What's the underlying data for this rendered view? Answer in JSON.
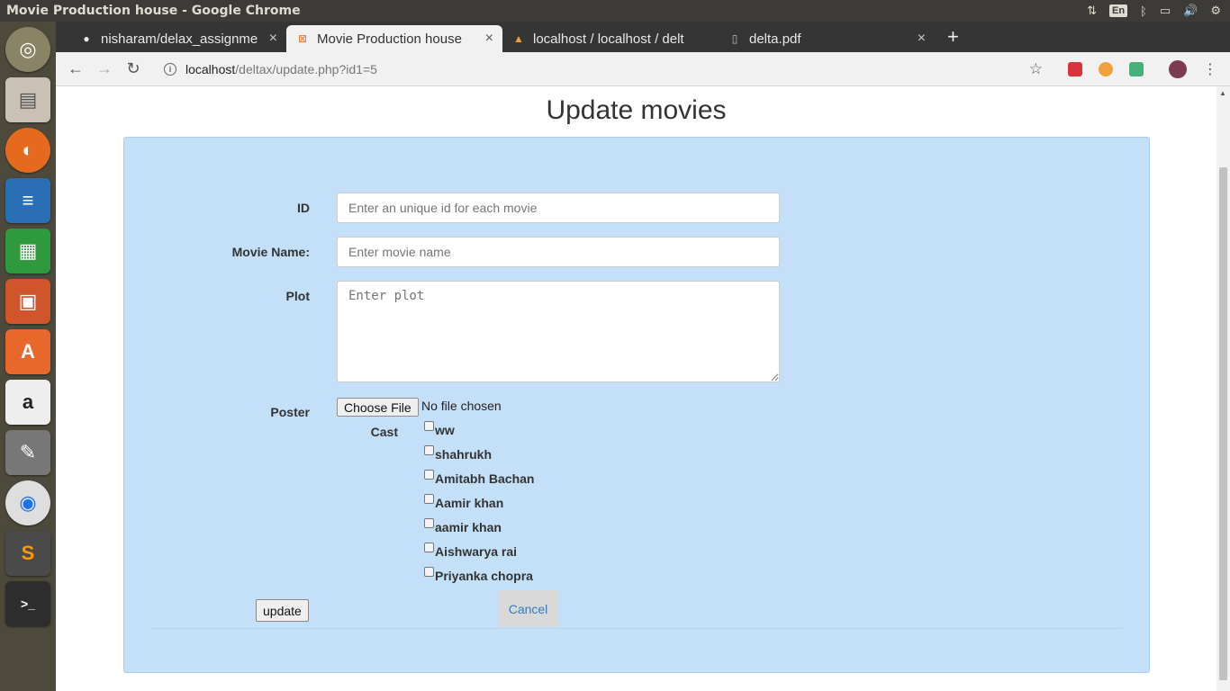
{
  "os": {
    "window_title": "Movie Production house - Google Chrome",
    "lang": "En"
  },
  "tabs": [
    {
      "label": "nisharam/delax_assignme",
      "icon": "github-icon"
    },
    {
      "label": "Movie Production house",
      "icon": "xampp-icon",
      "active": true
    },
    {
      "label": "localhost / localhost / delt",
      "icon": "phpmyadmin-icon"
    },
    {
      "label": "delta.pdf",
      "icon": "document-icon"
    }
  ],
  "toolbar": {
    "url_host": "localhost",
    "url_path": "/deltax/update.php?id1=5"
  },
  "page": {
    "title": "Update movies"
  },
  "form": {
    "id_label": "ID",
    "id_placeholder": "Enter an unique id for each movie",
    "name_label": "Movie Name:",
    "name_placeholder": "Enter movie name",
    "plot_label": "Plot",
    "plot_placeholder": "Enter plot",
    "poster_label": "Poster",
    "file_button": "Choose File",
    "file_status": "No file chosen",
    "cast_label": "Cast",
    "cast": [
      "ww",
      "shahrukh",
      "Amitabh Bachan",
      "Aamir khan",
      "aamir khan",
      "Aishwarya rai",
      "Priyanka chopra"
    ],
    "update_label": "update",
    "cancel_label": "Cancel"
  },
  "colors": {
    "panel_bg": "#c4e0f9",
    "link": "#337ab7"
  }
}
